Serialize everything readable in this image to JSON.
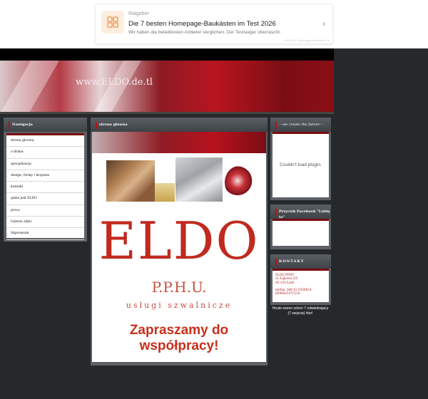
{
  "ad": {
    "category": "Ratgeber",
    "title": "Die 7 besten Homepage-Baukästen im Test 2026",
    "subtitle": "Wir haben die beliebtesten Anbieter verglichen. Der Testsieger überrascht.",
    "footer": "ANZEIGE homepage-baukasten.de",
    "icon": "grid-icon",
    "chevron": "›"
  },
  "header": {
    "url": "www.ELDO.de.tl"
  },
  "nav": {
    "title": "Nawigacja",
    "items": [
      {
        "label": "strona glowna"
      },
      {
        "label": "o firmie"
      },
      {
        "label": "specjalizacja"
      },
      {
        "label": "design, formy i krojenie"
      },
      {
        "label": "kontakt"
      },
      {
        "label": "gdzie jest ELDO"
      },
      {
        "label": "praca"
      },
      {
        "label": "Galeria zdjec"
      },
      {
        "label": "Impressum"
      }
    ]
  },
  "main": {
    "title": "strona glowna",
    "logo_text": "ELDO",
    "pphu": "P.P.H.U.",
    "uslugi": "usługi szwalnicze",
    "invite": "Zapraszamy do współpracy!"
  },
  "right": {
    "future_title": "---we create the future---",
    "plugin_message": "Couldn't load plugin.",
    "facebook_title": "Przycisk Facebook \"Lubię to\"",
    "kontakt_title": "KONTAKT",
    "kontakt_lines": [
      "ELDO PPHU",
      "ul. Łąkowa 3/5",
      "93-130 Łódź",
      "",
      "tel/fax. 048 42 6356614",
      "0048422357216"
    ]
  },
  "counter": {
    "line1": "Heute waren schon 7 odwiedzajacy",
    "line2": "(7 wejscia) hier!"
  },
  "colors": {
    "page_bg": "#25292c",
    "brand_red": "#c02a1f",
    "header_dark_red": "#7a0d12"
  }
}
